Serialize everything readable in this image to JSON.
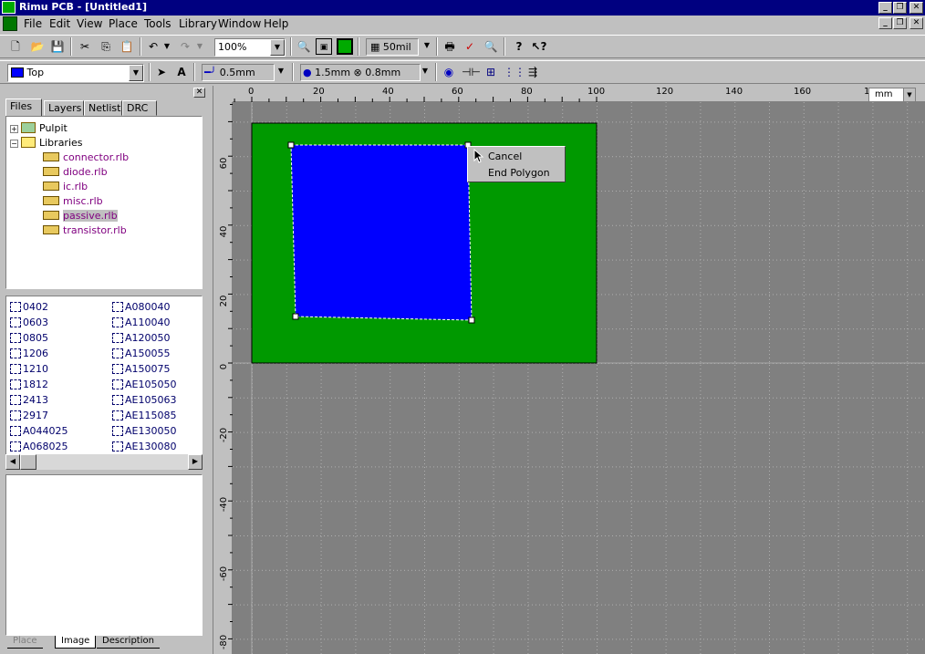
{
  "window": {
    "title": "Rimu PCB - [Untitled1]"
  },
  "menubar": {
    "items": [
      "File",
      "Edit",
      "View",
      "Place",
      "Tools",
      "Library",
      "Window",
      "Help"
    ]
  },
  "toolbar1": {
    "zoom": "100%",
    "grid": "50mil"
  },
  "toolbar2": {
    "layer": "Top",
    "track_width": "0.5mm",
    "via_size": "1.5mm",
    "via_hole": "⊗ 0.8mm"
  },
  "panel": {
    "tabs": [
      "Files",
      "Layers",
      "Netlist",
      "DRC"
    ],
    "tree": {
      "root": "Pulpit",
      "libraries_label": "Libraries",
      "libraries": [
        "connector.rlb",
        "diode.rlb",
        "ic.rlb",
        "misc.rlb",
        "passive.rlb",
        "transistor.rlb"
      ],
      "selected": "passive.rlb"
    },
    "parts_left": [
      "0402",
      "0603",
      "0805",
      "1206",
      "1210",
      "1812",
      "2413",
      "2917",
      "A044025",
      "A068025"
    ],
    "parts_right": [
      "A080040",
      "A110040",
      "A120050",
      "A150055",
      "A150075",
      "AE105050",
      "AE105063",
      "AE115085",
      "AE130050",
      "AE130080"
    ],
    "bottom_tabs": [
      "Place",
      "Image",
      "Description"
    ]
  },
  "ruler": {
    "top_labels": [
      "0",
      "20",
      "40",
      "60",
      "80",
      "100",
      "120",
      "140",
      "160",
      "1"
    ],
    "left_labels": [
      "60",
      "40",
      "20",
      "0",
      "-20",
      "-40",
      "-60",
      "-80"
    ],
    "unit": "mm"
  },
  "context_menu": {
    "items": [
      "Cancel",
      "End Polygon"
    ]
  },
  "colors": {
    "board": "#009900",
    "polygon": "#0000ff",
    "canvas": "#808080",
    "title_bar": "#000080"
  }
}
